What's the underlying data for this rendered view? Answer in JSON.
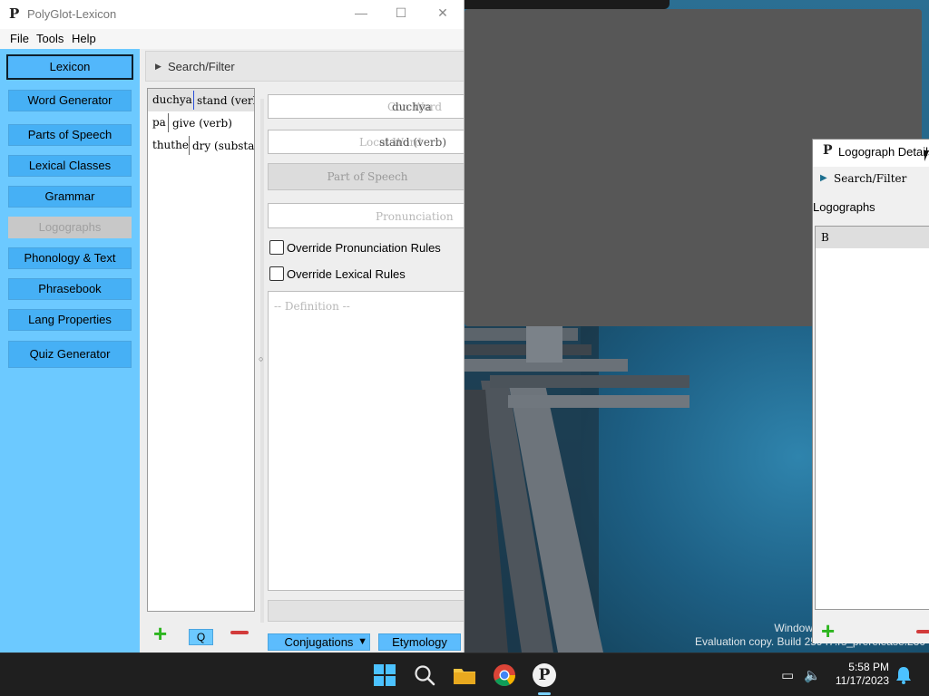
{
  "colors": {
    "sidebar_bg": "#6cc9ff",
    "sidebar_button": "#46b0f5",
    "accent_add": "#2db51f",
    "accent_remove": "#d23b3b",
    "taskbar_bg": "#1f1f1f"
  },
  "main_window": {
    "title": "PolyGlot-Lexicon",
    "app_icon": "P",
    "controls": {
      "minimize": "—",
      "maximize": "☐",
      "close": "✕"
    },
    "menu": [
      "File",
      "Tools",
      "Help"
    ],
    "sidebar": [
      {
        "label": "Lexicon",
        "state": "active"
      },
      {
        "label": "Word Generator",
        "state": "normal"
      },
      {
        "label": "Parts of Speech",
        "state": "normal"
      },
      {
        "label": "Lexical Classes",
        "state": "normal"
      },
      {
        "label": "Grammar",
        "state": "normal"
      },
      {
        "label": "Logographs",
        "state": "disabled"
      },
      {
        "label": "Phonology & Text",
        "state": "normal"
      },
      {
        "label": "Phrasebook",
        "state": "normal"
      },
      {
        "label": "Lang Properties",
        "state": "normal"
      },
      {
        "label": "Quiz Generator",
        "state": "normal"
      }
    ],
    "search_filter": "Search/Filter",
    "words": [
      {
        "con": "duchya",
        "local": "stand (verb)",
        "selected": true
      },
      {
        "con": "pa",
        "local": "give (verb)",
        "selected": false
      },
      {
        "con": "thuthe",
        "local": "dry (substance)",
        "selected": false
      }
    ],
    "form": {
      "con_word_placeholder": "Con Word",
      "con_word_value": "duchya",
      "local_word_placeholder": "Local Word",
      "local_word_value": "stand (verb)",
      "part_of_speech": "Part of Speech",
      "pronunciation_placeholder": "Pronunciation",
      "override_pronunciation": "Override Pronunciation Rules",
      "override_lexical": "Override Lexical Rules",
      "definition_placeholder": "-- Definition --"
    },
    "buttons": {
      "add": "+",
      "quick_search": "Q",
      "conjugations": "Conjugations",
      "conjugations_arrow": "▼",
      "etymology": "Etymology"
    }
  },
  "logograph_window": {
    "title": "Logograph Details",
    "app_icon": "P",
    "search_filter": "Search/Filter",
    "section": "Logographs",
    "items": [
      "B"
    ],
    "add": "+"
  },
  "desktop": {
    "watermark_line1": "Window",
    "watermark_line2": "Evaluation copy. Build 25947.rs_prerelease.230"
  },
  "taskbar": {
    "time": "5:58 PM",
    "date": "11/17/2023",
    "pinned_app_letter": "P"
  }
}
